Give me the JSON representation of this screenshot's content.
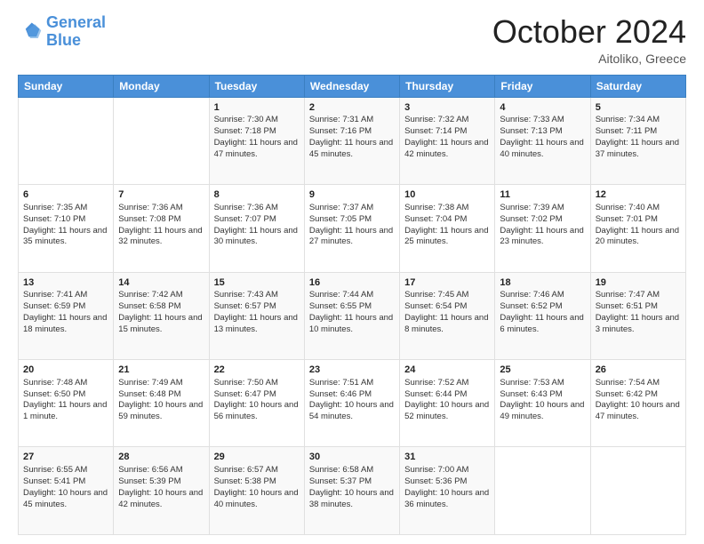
{
  "logo": {
    "line1": "General",
    "line2": "Blue"
  },
  "title": "October 2024",
  "location": "Aitoliko, Greece",
  "days_header": [
    "Sunday",
    "Monday",
    "Tuesday",
    "Wednesday",
    "Thursday",
    "Friday",
    "Saturday"
  ],
  "weeks": [
    [
      {
        "day": "",
        "sunrise": "",
        "sunset": "",
        "daylight": ""
      },
      {
        "day": "",
        "sunrise": "",
        "sunset": "",
        "daylight": ""
      },
      {
        "day": "1",
        "sunrise": "Sunrise: 7:30 AM",
        "sunset": "Sunset: 7:18 PM",
        "daylight": "Daylight: 11 hours and 47 minutes."
      },
      {
        "day": "2",
        "sunrise": "Sunrise: 7:31 AM",
        "sunset": "Sunset: 7:16 PM",
        "daylight": "Daylight: 11 hours and 45 minutes."
      },
      {
        "day": "3",
        "sunrise": "Sunrise: 7:32 AM",
        "sunset": "Sunset: 7:14 PM",
        "daylight": "Daylight: 11 hours and 42 minutes."
      },
      {
        "day": "4",
        "sunrise": "Sunrise: 7:33 AM",
        "sunset": "Sunset: 7:13 PM",
        "daylight": "Daylight: 11 hours and 40 minutes."
      },
      {
        "day": "5",
        "sunrise": "Sunrise: 7:34 AM",
        "sunset": "Sunset: 7:11 PM",
        "daylight": "Daylight: 11 hours and 37 minutes."
      }
    ],
    [
      {
        "day": "6",
        "sunrise": "Sunrise: 7:35 AM",
        "sunset": "Sunset: 7:10 PM",
        "daylight": "Daylight: 11 hours and 35 minutes."
      },
      {
        "day": "7",
        "sunrise": "Sunrise: 7:36 AM",
        "sunset": "Sunset: 7:08 PM",
        "daylight": "Daylight: 11 hours and 32 minutes."
      },
      {
        "day": "8",
        "sunrise": "Sunrise: 7:36 AM",
        "sunset": "Sunset: 7:07 PM",
        "daylight": "Daylight: 11 hours and 30 minutes."
      },
      {
        "day": "9",
        "sunrise": "Sunrise: 7:37 AM",
        "sunset": "Sunset: 7:05 PM",
        "daylight": "Daylight: 11 hours and 27 minutes."
      },
      {
        "day": "10",
        "sunrise": "Sunrise: 7:38 AM",
        "sunset": "Sunset: 7:04 PM",
        "daylight": "Daylight: 11 hours and 25 minutes."
      },
      {
        "day": "11",
        "sunrise": "Sunrise: 7:39 AM",
        "sunset": "Sunset: 7:02 PM",
        "daylight": "Daylight: 11 hours and 23 minutes."
      },
      {
        "day": "12",
        "sunrise": "Sunrise: 7:40 AM",
        "sunset": "Sunset: 7:01 PM",
        "daylight": "Daylight: 11 hours and 20 minutes."
      }
    ],
    [
      {
        "day": "13",
        "sunrise": "Sunrise: 7:41 AM",
        "sunset": "Sunset: 6:59 PM",
        "daylight": "Daylight: 11 hours and 18 minutes."
      },
      {
        "day": "14",
        "sunrise": "Sunrise: 7:42 AM",
        "sunset": "Sunset: 6:58 PM",
        "daylight": "Daylight: 11 hours and 15 minutes."
      },
      {
        "day": "15",
        "sunrise": "Sunrise: 7:43 AM",
        "sunset": "Sunset: 6:57 PM",
        "daylight": "Daylight: 11 hours and 13 minutes."
      },
      {
        "day": "16",
        "sunrise": "Sunrise: 7:44 AM",
        "sunset": "Sunset: 6:55 PM",
        "daylight": "Daylight: 11 hours and 10 minutes."
      },
      {
        "day": "17",
        "sunrise": "Sunrise: 7:45 AM",
        "sunset": "Sunset: 6:54 PM",
        "daylight": "Daylight: 11 hours and 8 minutes."
      },
      {
        "day": "18",
        "sunrise": "Sunrise: 7:46 AM",
        "sunset": "Sunset: 6:52 PM",
        "daylight": "Daylight: 11 hours and 6 minutes."
      },
      {
        "day": "19",
        "sunrise": "Sunrise: 7:47 AM",
        "sunset": "Sunset: 6:51 PM",
        "daylight": "Daylight: 11 hours and 3 minutes."
      }
    ],
    [
      {
        "day": "20",
        "sunrise": "Sunrise: 7:48 AM",
        "sunset": "Sunset: 6:50 PM",
        "daylight": "Daylight: 11 hours and 1 minute."
      },
      {
        "day": "21",
        "sunrise": "Sunrise: 7:49 AM",
        "sunset": "Sunset: 6:48 PM",
        "daylight": "Daylight: 10 hours and 59 minutes."
      },
      {
        "day": "22",
        "sunrise": "Sunrise: 7:50 AM",
        "sunset": "Sunset: 6:47 PM",
        "daylight": "Daylight: 10 hours and 56 minutes."
      },
      {
        "day": "23",
        "sunrise": "Sunrise: 7:51 AM",
        "sunset": "Sunset: 6:46 PM",
        "daylight": "Daylight: 10 hours and 54 minutes."
      },
      {
        "day": "24",
        "sunrise": "Sunrise: 7:52 AM",
        "sunset": "Sunset: 6:44 PM",
        "daylight": "Daylight: 10 hours and 52 minutes."
      },
      {
        "day": "25",
        "sunrise": "Sunrise: 7:53 AM",
        "sunset": "Sunset: 6:43 PM",
        "daylight": "Daylight: 10 hours and 49 minutes."
      },
      {
        "day": "26",
        "sunrise": "Sunrise: 7:54 AM",
        "sunset": "Sunset: 6:42 PM",
        "daylight": "Daylight: 10 hours and 47 minutes."
      }
    ],
    [
      {
        "day": "27",
        "sunrise": "Sunrise: 6:55 AM",
        "sunset": "Sunset: 5:41 PM",
        "daylight": "Daylight: 10 hours and 45 minutes."
      },
      {
        "day": "28",
        "sunrise": "Sunrise: 6:56 AM",
        "sunset": "Sunset: 5:39 PM",
        "daylight": "Daylight: 10 hours and 42 minutes."
      },
      {
        "day": "29",
        "sunrise": "Sunrise: 6:57 AM",
        "sunset": "Sunset: 5:38 PM",
        "daylight": "Daylight: 10 hours and 40 minutes."
      },
      {
        "day": "30",
        "sunrise": "Sunrise: 6:58 AM",
        "sunset": "Sunset: 5:37 PM",
        "daylight": "Daylight: 10 hours and 38 minutes."
      },
      {
        "day": "31",
        "sunrise": "Sunrise: 7:00 AM",
        "sunset": "Sunset: 5:36 PM",
        "daylight": "Daylight: 10 hours and 36 minutes."
      },
      {
        "day": "",
        "sunrise": "",
        "sunset": "",
        "daylight": ""
      },
      {
        "day": "",
        "sunrise": "",
        "sunset": "",
        "daylight": ""
      }
    ]
  ]
}
